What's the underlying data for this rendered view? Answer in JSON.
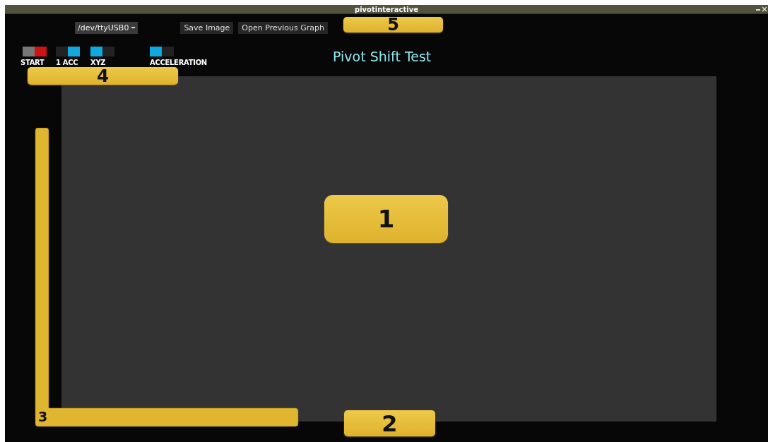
{
  "window": {
    "title": "pivotinteractive"
  },
  "toolbar": {
    "port": "/dev/ttyUSB0",
    "buttons": [
      "Save Image",
      "Open Previous Graph"
    ]
  },
  "toggles": [
    {
      "label": "START",
      "kind": "start",
      "on": true
    },
    {
      "label": "1 ACC",
      "kind": "mode",
      "on": true
    },
    {
      "label": "XYZ",
      "kind": "mode",
      "on": false
    },
    {
      "label": "ACCELERATION",
      "kind": "mode",
      "on": false
    }
  ],
  "graph": {
    "title": "Pivot Shift Test"
  },
  "callouts": [
    {
      "label": "5",
      "kind": "box"
    },
    {
      "label": "4",
      "kind": "box"
    },
    {
      "label": "1",
      "kind": "box"
    },
    {
      "label": "3",
      "kind": "bracket"
    },
    {
      "label": "2",
      "kind": "box"
    }
  ]
}
